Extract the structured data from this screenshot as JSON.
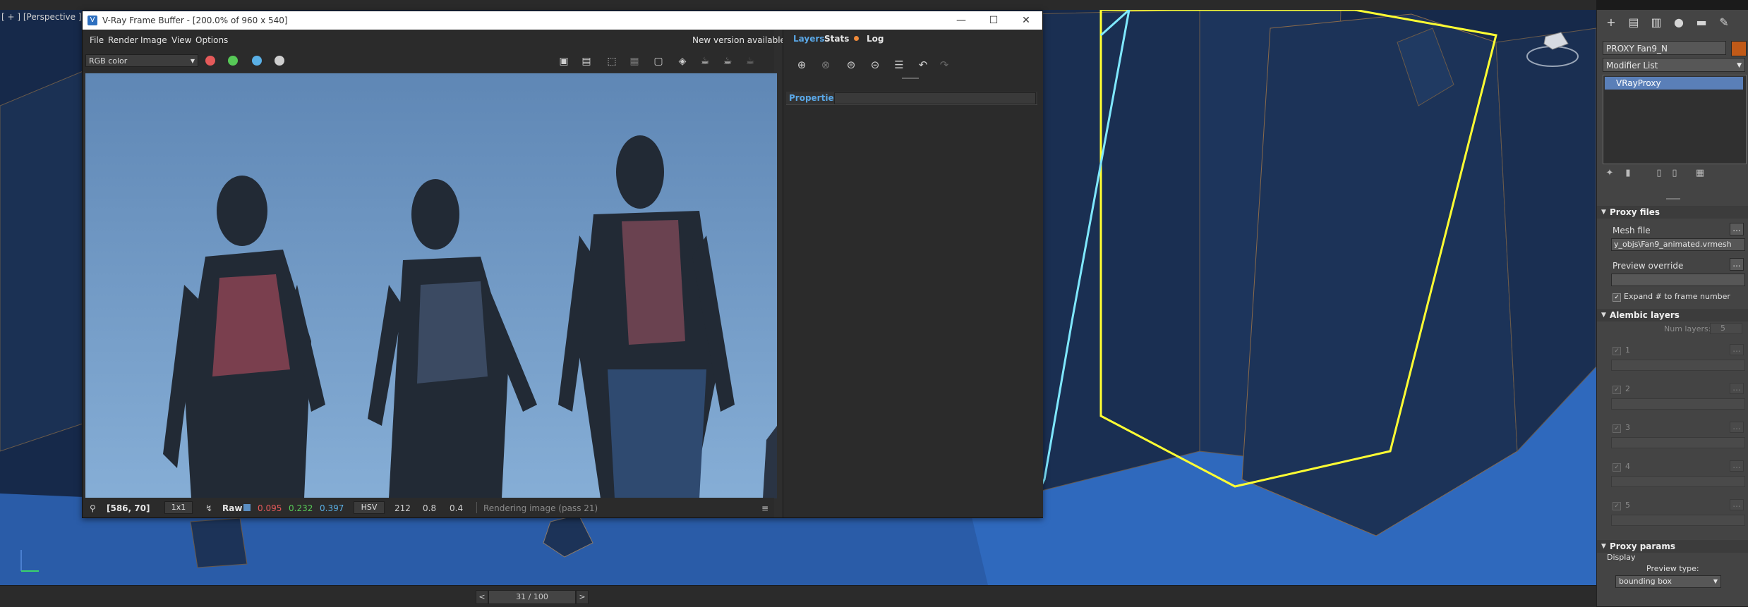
{
  "viewport": {
    "label": "[ + ] [Perspective ] [St",
    "colors": {
      "background": "#16294a",
      "selection_yellow": "#ffff33",
      "selection_cyan": "#7fe8ff"
    }
  },
  "timeline": {
    "prev": "<",
    "next": ">",
    "frame": "31 / 100"
  },
  "command_panel": {
    "tabs": [
      "create-icon",
      "modify-icon",
      "hierarchy-icon",
      "motion-icon",
      "display-icon",
      "utilities-icon"
    ],
    "object_name": "PROXY Fan9_N",
    "object_color": "#c15a18",
    "modifier_list": "Modifier List",
    "modifier_stack": [
      "VRayProxy"
    ],
    "proxy_files": {
      "title": "Proxy files",
      "mesh_file_label": "Mesh file",
      "mesh_file_value": "y_objs\\Fan9_animated.vrmesh",
      "dots": "...",
      "preview_override_label": "Preview override",
      "expand_label": "Expand # to frame number"
    },
    "alembic_layers": {
      "title": "Alembic layers",
      "num_layers_label": "Num layers:",
      "num_layers_value": "5",
      "layers": [
        "1",
        "2",
        "3",
        "4",
        "5"
      ]
    },
    "proxy_params": {
      "title": "Proxy params",
      "display_label": "Display",
      "preview_type_label": "Preview type:",
      "preview_type_value": "bounding box"
    }
  },
  "vfb": {
    "title": "V-Ray Frame Buffer - [200.0% of 960 x 540]",
    "menu": [
      "File",
      "Render",
      "Image",
      "View",
      "Options"
    ],
    "new_version": "New version available!",
    "channel": "RGB color",
    "channel_dot_colors": [
      "#e55a5a",
      "#57c957",
      "#5ab0e6"
    ],
    "status": {
      "coords": "[586, 70]",
      "sampling": "1x1",
      "mode": "Raw",
      "r": "0.095",
      "g": "0.232",
      "b": "0.397",
      "space": "HSV",
      "h": "212",
      "s": "0.8",
      "v": "0.4",
      "message": "Rendering image (pass 21)"
    },
    "side": {
      "tabs": {
        "layers": "Layers",
        "stats": "Stats",
        "log": "Log"
      },
      "properties": "Properties"
    }
  }
}
